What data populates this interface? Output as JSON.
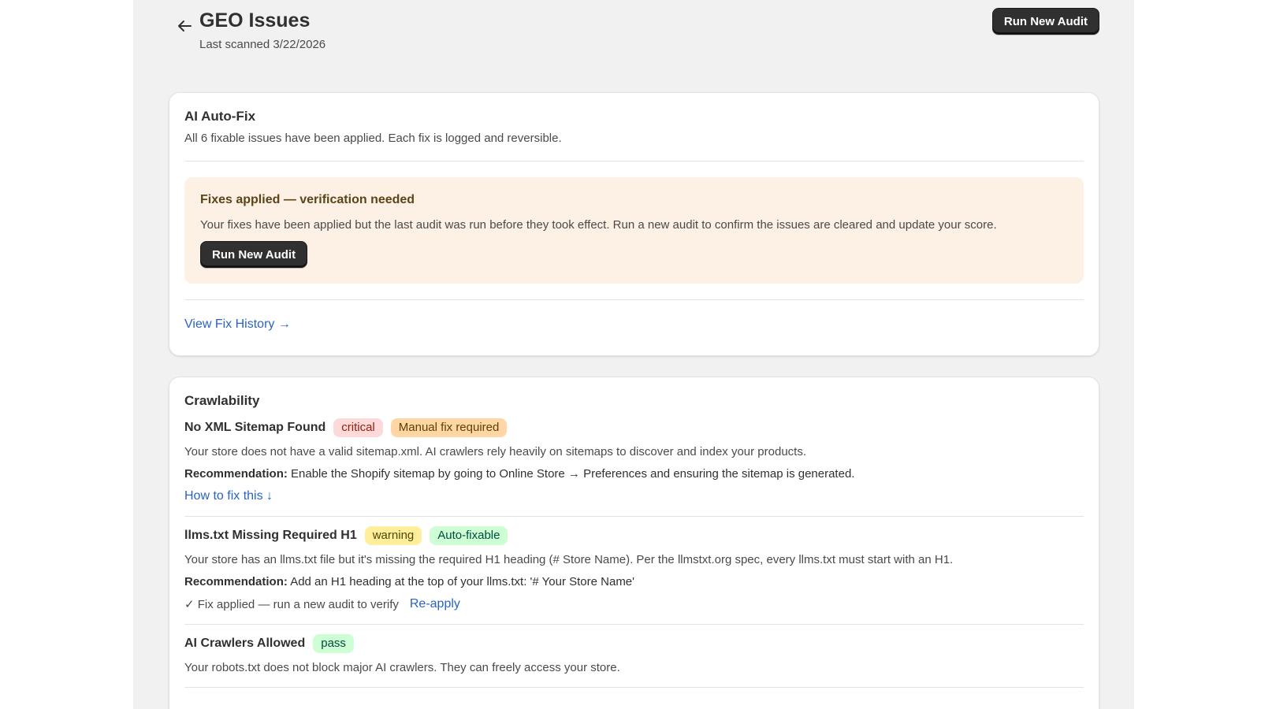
{
  "header": {
    "title": "GEO Issues",
    "subtitle": "Last scanned 3/22/2026",
    "run_audit_label": "Run New Audit",
    "back_icon": "arrow-left-icon"
  },
  "autofix": {
    "title": "AI Auto-Fix",
    "description": "All 6 fixable issues have been applied. Each fix is logged and reversible.",
    "banner": {
      "title": "Fixes applied — verification needed",
      "text": "Your fixes have been applied but the last audit was run before they took effect. Run a new audit to confirm the issues are cleared and update your score.",
      "button_label": "Run New Audit"
    },
    "history_link": "View Fix History →"
  },
  "crawlability": {
    "title": "Crawlability",
    "issues": [
      {
        "title": "No XML Sitemap Found",
        "badges": [
          "critical",
          "Manual fix required"
        ],
        "description": "Your store does not have a valid sitemap.xml. AI crawlers rely heavily on sitemaps to discover and index your products.",
        "rec_label": "Recommendation:",
        "rec_text": " Enable the Shopify sitemap by going to Online Store → Preferences and ensuring the sitemap is generated.",
        "action": "How to fix this ↓"
      },
      {
        "title": "llms.txt Missing Required H1",
        "badges": [
          "warning",
          "Auto-fixable"
        ],
        "description": "Your store has an llms.txt file but it's missing the required H1 heading (# Store Name). Per the llmstxt.org spec, every llms.txt must start with an H1.",
        "rec_label": "Recommendation:",
        "rec_text": " Add an H1 heading at the top of your llms.txt: '# Your Store Name'",
        "applied_text": "✓ Fix applied — run a new audit to verify",
        "reapply": "Re-apply"
      },
      {
        "title": "AI Crawlers Allowed",
        "badges": [
          "pass"
        ],
        "description": "Your robots.txt does not block major AI crawlers. They can freely access your store."
      }
    ]
  },
  "colors": {
    "accent_link": "#2a63c5",
    "button_dark": "#303030",
    "banner_bg": "#fdf0e5",
    "page_bg": "#f1f1f1"
  }
}
